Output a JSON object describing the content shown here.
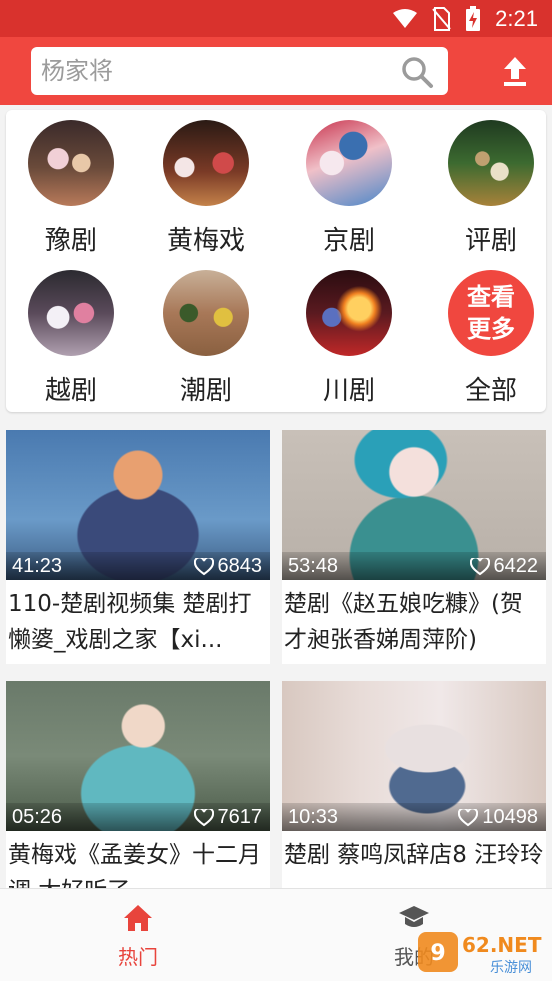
{
  "status_bar": {
    "time": "2:21",
    "icons": [
      "wifi-icon",
      "no-sim-icon",
      "battery-charging-icon"
    ]
  },
  "header": {
    "search_placeholder": "杨家将",
    "search_icon": "search-icon",
    "upload_icon": "upload-icon",
    "colors": {
      "statusbar": "#d9322d",
      "toolbar": "#f0473f"
    }
  },
  "categories": [
    {
      "label": "豫剧"
    },
    {
      "label": "黄梅戏"
    },
    {
      "label": "京剧"
    },
    {
      "label": "评剧"
    },
    {
      "label": "越剧"
    },
    {
      "label": "潮剧"
    },
    {
      "label": "川剧"
    },
    {
      "label": "全部",
      "circle_text": [
        "查看",
        "更多"
      ]
    }
  ],
  "videos": [
    {
      "duration": "41:23",
      "likes": "6843",
      "title": "110-楚剧视频集 楚剧打懒婆_戏剧之家【xi..."
    },
    {
      "duration": "53:48",
      "likes": "6422",
      "title": "楚剧《赵五娘吃糠》(贺才昶张香娣周萍阶)"
    },
    {
      "duration": "05:26",
      "likes": "7617",
      "title": "黄梅戏《孟姜女》十二月调 太好听了"
    },
    {
      "duration": "10:33",
      "likes": "10498",
      "title": "楚剧 蔡鸣凤辞店8 汪玲玲"
    }
  ],
  "bottom_nav": [
    {
      "label": "热门",
      "icon": "home-icon",
      "active": true,
      "color": "#e8443c"
    },
    {
      "label": "我的",
      "icon": "graduation-cap-icon",
      "active": false,
      "color": "#555555"
    }
  ],
  "watermark": {
    "text": "962.NET",
    "subtext": "乐游网"
  }
}
